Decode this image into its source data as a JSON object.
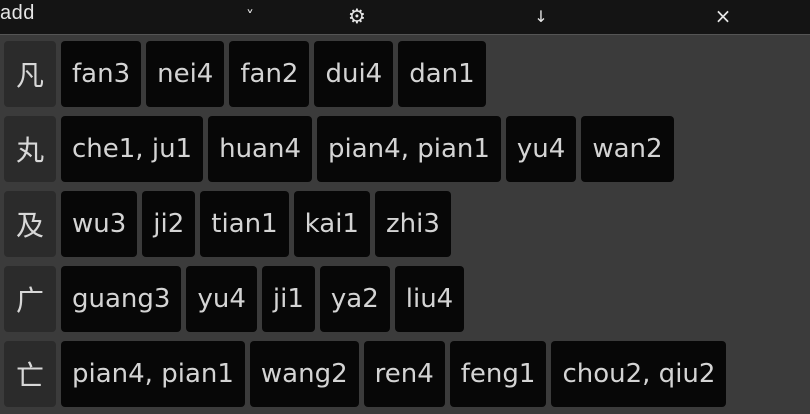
{
  "toolbar": {
    "mode_text": "add",
    "dropdown_glyph": "˅",
    "settings_glyph": "⚙",
    "download_glyph": "↓",
    "close_glyph": "×"
  },
  "rows": [
    {
      "hanzi": "凡",
      "readings": [
        "fan3",
        "nei4",
        "fan2",
        "dui4",
        "dan1"
      ]
    },
    {
      "hanzi": "丸",
      "readings": [
        "che1, ju1",
        "huan4",
        "pian4, pian1",
        "yu4",
        "wan2"
      ]
    },
    {
      "hanzi": "及",
      "readings": [
        "wu3",
        "ji2",
        "tian1",
        "kai1",
        "zhi3"
      ]
    },
    {
      "hanzi": "广",
      "readings": [
        "guang3",
        "yu4",
        "ji1",
        "ya2",
        "liu4"
      ]
    },
    {
      "hanzi": "亡",
      "readings": [
        "pian4, pian1",
        "wang2",
        "ren4",
        "feng1",
        "chou2, qiu2"
      ]
    }
  ]
}
